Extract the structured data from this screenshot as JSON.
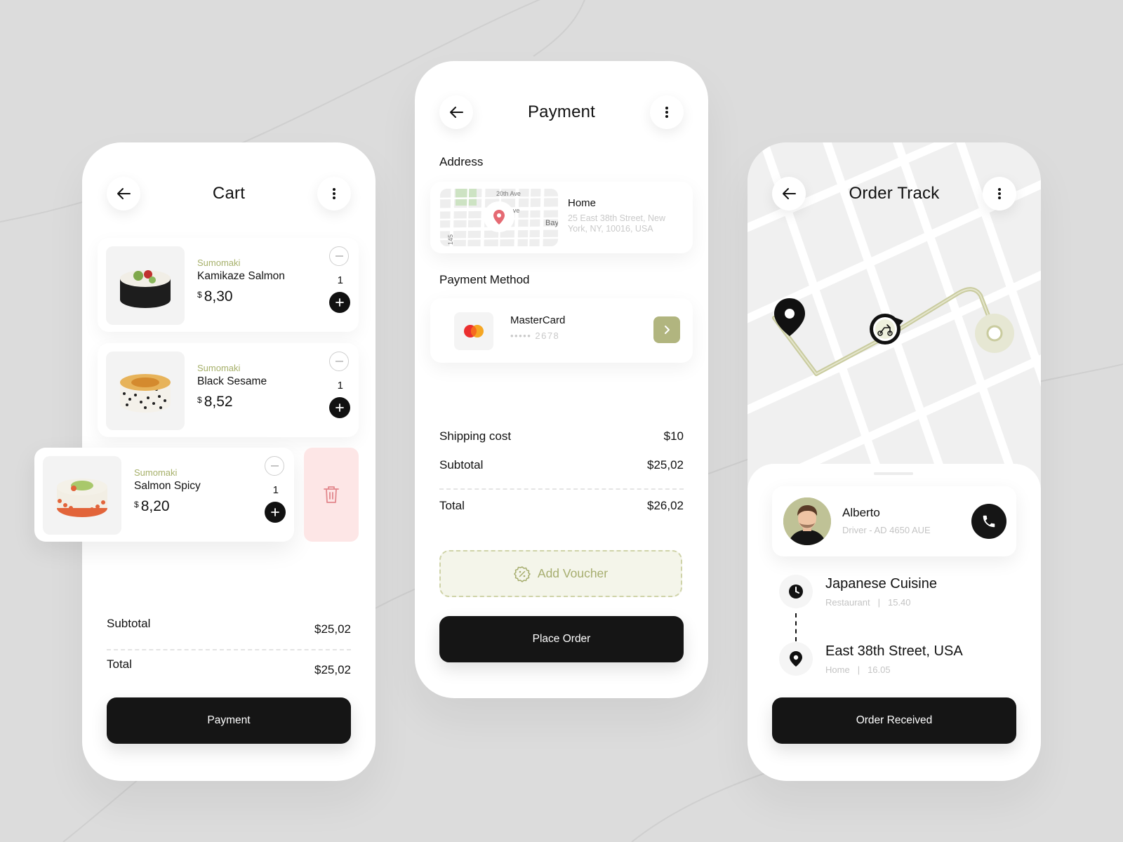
{
  "colors": {
    "background": "#dcdcdc",
    "accent_olive": "#b1b57f",
    "brand_text": "#a6b06a",
    "button_dark": "#151515",
    "delete_bg": "#fde6e6",
    "delete_icon": "#e2878c",
    "voucher_bg": "#f4f5ea"
  },
  "cart": {
    "title": "Cart",
    "items": [
      {
        "brand": "Sumomaki",
        "name": "Kamikaze Salmon",
        "currency": "$",
        "price": "8,30",
        "qty": "1"
      },
      {
        "brand": "Sumomaki",
        "name": "Black Sesame",
        "currency": "$",
        "price": "8,52",
        "qty": "1"
      },
      {
        "brand": "Sumomaki",
        "name": "Salmon Spicy",
        "currency": "$",
        "price": "8,20",
        "qty": "1"
      }
    ],
    "subtotal_label": "Subtotal",
    "subtotal_value": "$25,02",
    "total_label": "Total",
    "total_value": "$25,02",
    "button": "Payment"
  },
  "payment": {
    "title": "Payment",
    "address_label": "Address",
    "address": {
      "title": "Home",
      "line": "25 East 38th Street, New York, NY, 10016, USA",
      "map_labels": {
        "street_top": "20th Ave",
        "street_mid": "Ave",
        "bay": "Bay",
        "side": "145"
      }
    },
    "method_label": "Payment Method",
    "card": {
      "name": "MasterCard",
      "number": "••••• 2678"
    },
    "shipping_label": "Shipping cost",
    "shipping_value": "$10",
    "subtotal_label": "Subtotal",
    "subtotal_value": "$25,02",
    "total_label": "Total",
    "total_value": "$26,02",
    "voucher": "Add Voucher",
    "button": "Place Order"
  },
  "track": {
    "title": "Order Track",
    "driver": {
      "name": "Alberto",
      "info": "Driver - AD 4650 AUE"
    },
    "stops": [
      {
        "title": "Japanese Cuisine",
        "type": "Restaurant",
        "time": "15.40",
        "icon": "clock-icon"
      },
      {
        "title": "East 38th Street, USA",
        "type": "Home",
        "time": "16.05",
        "icon": "location-pin-icon"
      }
    ],
    "button": "Order Received"
  }
}
